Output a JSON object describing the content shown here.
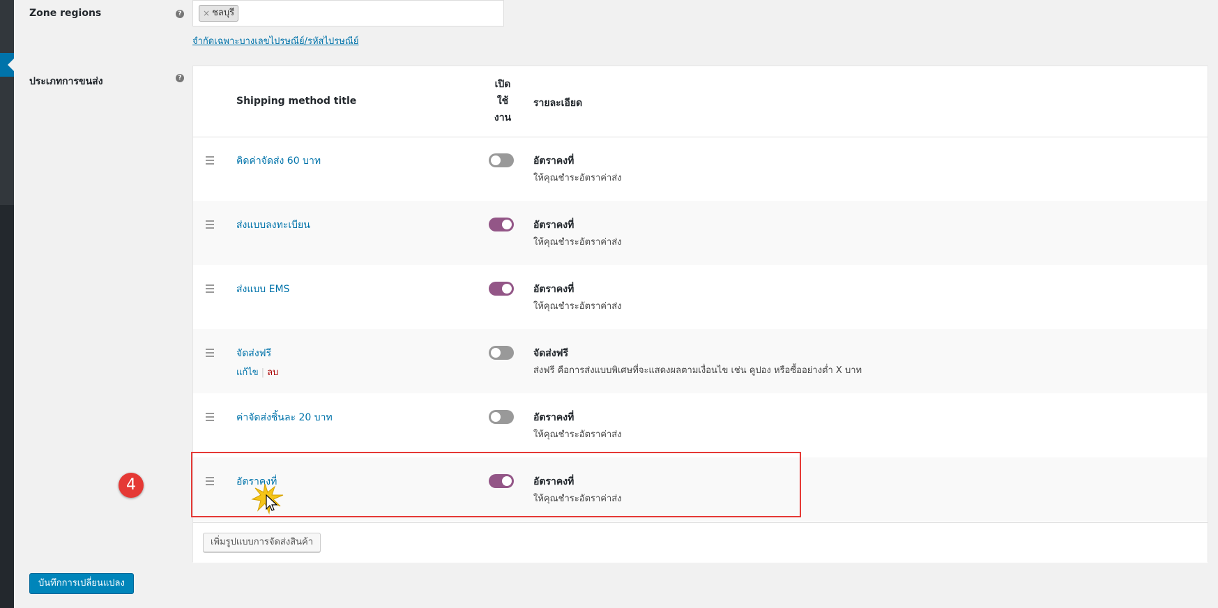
{
  "zone_regions": {
    "label": "Zone regions",
    "tags": [
      {
        "label": "ชลบุรี",
        "remove": "×"
      }
    ],
    "limit_link": "จำกัดเฉพาะบางเลขไปรษณีย์/รหัสไปรษณีย์"
  },
  "shipping_methods": {
    "label": "ประเภทการขนส่ง",
    "headers": {
      "title": "Shipping method title",
      "enabled_line1": "เปิด",
      "enabled_line2": "ใช้",
      "enabled_line3": "งาน",
      "description": "รายละเอียด"
    },
    "rows": [
      {
        "title": "คิดค่าจัดส่ง 60 บาท",
        "enabled": false,
        "desc_title": "อัตราคงที่",
        "desc_text": "ให้คุณชำระอัตราค่าส่ง"
      },
      {
        "title": "ส่งแบบลงทะเบียน",
        "enabled": true,
        "desc_title": "อัตราคงที่",
        "desc_text": "ให้คุณชำระอัตราค่าส่ง"
      },
      {
        "title": "ส่งแบบ EMS",
        "enabled": true,
        "desc_title": "อัตราคงที่",
        "desc_text": "ให้คุณชำระอัตราค่าส่ง"
      },
      {
        "title": "จัดส่งฟรี",
        "enabled": false,
        "desc_title": "จัดส่งฟรี",
        "desc_text": "ส่งฟรี คือการส่งแบบพิเศษที่จะแสดงผลตามเงื่อนไข เช่น คูปอง หรือซื้ออย่างต่ำ X บาท",
        "edit": "แก้ไข",
        "delete": "ลบ"
      },
      {
        "title": "ค่าจัดส่งชิ้นละ 20 บาท",
        "enabled": false,
        "desc_title": "อัตราคงที่",
        "desc_text": "ให้คุณชำระอัตราค่าส่ง"
      },
      {
        "title": "อัตราคงที่",
        "enabled": true,
        "desc_title": "อัตราคงที่",
        "desc_text": "ให้คุณชำระอัตราค่าส่ง"
      }
    ],
    "add_button": "เพิ่มรูปแบบการจัดส่งสินค้า"
  },
  "save_button": "บันทึกการเปลี่ยนแปลง",
  "annotation": {
    "step": "4"
  },
  "colors": {
    "toggle_on": "#935687",
    "toggle_off": "#999999",
    "link": "#0073aa",
    "highlight": "#e53935",
    "primary": "#0085ba"
  },
  "icons": {
    "help": "help-icon",
    "drag": "drag-handle-icon",
    "remove": "remove-tag-icon",
    "cursor": "cursor-click-icon"
  }
}
